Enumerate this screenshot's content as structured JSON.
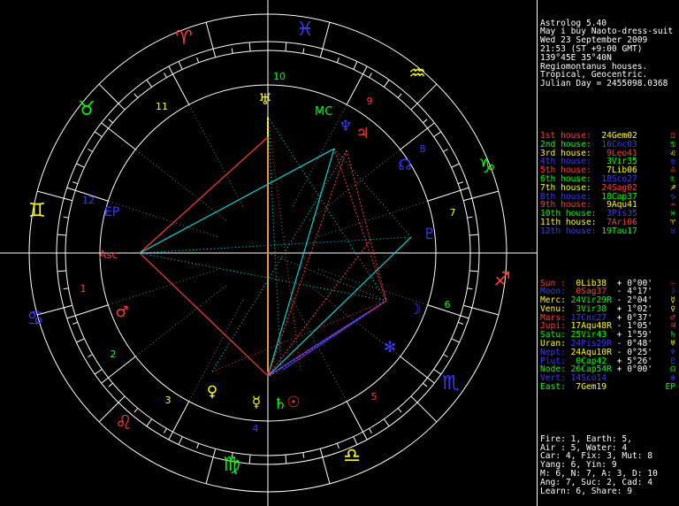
{
  "header": [
    "Astrolog 5.40",
    "May i buy Naoto-dress-suit",
    "Wed 23 September 2009",
    "21:53 (ST +9:00 GMT)",
    "139°45E 35°40N",
    "Regiomontanus houses.",
    "Tropical, Geocentric.",
    "Julian Day = 2455098.0368"
  ],
  "houses": [
    {
      "label": "1st house:",
      "value": "24Gem02",
      "icon": "♊",
      "color": "#ff3b3b",
      "vcolor": "#ffff00"
    },
    {
      "label": "2nd house:",
      "value": "16Cnc03",
      "icon": "♋",
      "color": "#00ff00",
      "vcolor": "#3a3aff"
    },
    {
      "label": "3rd house:",
      "value": " 9Leo41",
      "icon": "♌",
      "color": "#ffff00",
      "vcolor": "#ff3b3b"
    },
    {
      "label": "4th house:",
      "value": " 3Vir35",
      "icon": "♍",
      "color": "#3a3aff",
      "vcolor": "#00ff00"
    },
    {
      "label": "5th house:",
      "value": " 7Lib06",
      "icon": "♎",
      "color": "#ff3b3b",
      "vcolor": "#ffff00"
    },
    {
      "label": "6th house:",
      "value": "18Sco27",
      "icon": "♏",
      "color": "#00ff00",
      "vcolor": "#3a3aff"
    },
    {
      "label": "7th house:",
      "value": "24Sag02",
      "icon": "♐",
      "color": "#ffff00",
      "vcolor": "#ff3b3b"
    },
    {
      "label": "8th house:",
      "value": "18Cap37",
      "icon": "♑",
      "color": "#3a3aff",
      "vcolor": "#00ff00"
    },
    {
      "label": "9th house:",
      "value": " 9Aqu41",
      "icon": "♒",
      "color": "#ff3b3b",
      "vcolor": "#ffff00"
    },
    {
      "label": "10th house:",
      "value": " 3Pis35",
      "icon": "♓",
      "color": "#00ff00",
      "vcolor": "#3a3aff"
    },
    {
      "label": "11th house:",
      "value": " 7Ari06",
      "icon": "♈",
      "color": "#ffff00",
      "vcolor": "#ff3b3b"
    },
    {
      "label": "12th house:",
      "value": "19Tau17",
      "icon": "♉",
      "color": "#3a3aff",
      "vcolor": "#00ff00"
    }
  ],
  "planets": [
    {
      "label": "Sun :",
      "value": " 0Lib38",
      "info": " + 0°00'",
      "icon": "☉",
      "color": "#ff3b3b",
      "vcolor": "#ffff00"
    },
    {
      "label": "Moon:",
      "value": " 0Sag37",
      "info": " - 4°17'",
      "icon": "☽",
      "color": "#3a3aff",
      "vcolor": "#ff3b3b"
    },
    {
      "label": "Merc:",
      "value": "24Vir29R",
      "info": " - 2°04'",
      "icon": "☿",
      "color": "#ffff00",
      "vcolor": "#00ff00"
    },
    {
      "label": "Venu:",
      "value": " 3Vir38",
      "info": " + 1°02'",
      "icon": "♀",
      "color": "#ffff00",
      "vcolor": "#00ff00"
    },
    {
      "label": "Mars:",
      "value": "17Cnc27",
      "info": " + 0°37'",
      "icon": "♂",
      "color": "#ff3b3b",
      "vcolor": "#3a3aff"
    },
    {
      "label": "Jupi:",
      "value": "17Aqu48R",
      "info": " - 1°05'",
      "icon": "♃",
      "color": "#ff3b3b",
      "vcolor": "#ffff00"
    },
    {
      "label": "Satu:",
      "value": "25Vir43",
      "info": " + 1°59'",
      "icon": "♄",
      "color": "#00ff00",
      "vcolor": "#00ff00"
    },
    {
      "label": "Uran:",
      "value": "24Pis29R",
      "info": " - 0°48'",
      "icon": "♅",
      "color": "#ffff00",
      "vcolor": "#3a3aff"
    },
    {
      "label": "Nept:",
      "value": "24Aqu10R",
      "info": " - 0°25'",
      "icon": "♆",
      "color": "#3a3aff",
      "vcolor": "#ffff00"
    },
    {
      "label": "Plut:",
      "value": " 0Cap42",
      "info": " + 5°26'",
      "icon": "♇",
      "color": "#3a3aff",
      "vcolor": "#00ff00"
    },
    {
      "label": "Node:",
      "value": "26Cap54R",
      "info": " + 0°00'",
      "icon": "☊",
      "color": "#00ff00",
      "vcolor": "#00ff00"
    },
    {
      "label": "Vert:",
      "value": "14Sco14",
      "info": "",
      "icon": "✻",
      "color": "#3a3aff",
      "vcolor": "#3a3aff"
    },
    {
      "label": "East:",
      "value": " 7Gem19",
      "info": "",
      "icon": "EP",
      "color": "#00ff00",
      "vcolor": "#ffff00"
    }
  ],
  "stats": [
    "Fire: 1, Earth: 5,",
    "Air : 5, Water: 4",
    "Car: 4, Fix: 3, Mut: 8",
    "Yang: 6, Yin: 9",
    "M: 6, N: 7, A: 3, D: 10",
    "Ang: 7, Suc: 2, Cad: 4",
    "Learn: 6, Share: 9"
  ],
  "wheel": {
    "signs": [
      {
        "glyph": "♓",
        "color": "#3a3aff"
      },
      {
        "glyph": "♈",
        "color": "#ff3b3b"
      },
      {
        "glyph": "♉",
        "color": "#00ff00"
      },
      {
        "glyph": "♊",
        "color": "#ffff00"
      },
      {
        "glyph": "♋",
        "color": "#3a3aff"
      },
      {
        "glyph": "♌",
        "color": "#ff3b3b"
      },
      {
        "glyph": "♍",
        "color": "#00ff00"
      },
      {
        "glyph": "♎",
        "color": "#ffff00"
      },
      {
        "glyph": "♏",
        "color": "#3a3aff"
      },
      {
        "glyph": "♐",
        "color": "#ff3b3b"
      },
      {
        "glyph": "♑",
        "color": "#00ff00"
      },
      {
        "glyph": "♒",
        "color": "#ffff00"
      }
    ],
    "house_numbers": [
      {
        "n": "10",
        "color": "#00ff00"
      },
      {
        "n": "9",
        "color": "#ff3b3b"
      },
      {
        "n": "8",
        "color": "#3a3aff"
      },
      {
        "n": "7",
        "color": "#ffff00"
      },
      {
        "n": "6",
        "color": "#00ff00"
      },
      {
        "n": "5",
        "color": "#ff3b3b"
      },
      {
        "n": "4",
        "color": "#3a3aff"
      },
      {
        "n": "3",
        "color": "#ffff00"
      },
      {
        "n": "2",
        "color": "#00ff00"
      },
      {
        "n": "1",
        "color": "#ff3b3b"
      },
      {
        "n": "12",
        "color": "#3a3aff"
      },
      {
        "n": "11",
        "color": "#ffff00"
      }
    ],
    "asc_label": "Asc",
    "mc_label": "MC",
    "ep_label": "EP",
    "asc_color": "#ff3b3b",
    "mc_color": "#00ff00",
    "ep_color": "#3a3aff",
    "chart_planets": [
      {
        "glyph": "♅",
        "color": "#ffff00"
      },
      {
        "glyph": "♆",
        "color": "#3a3aff"
      },
      {
        "glyph": "♃",
        "color": "#ff3b3b"
      },
      {
        "glyph": "☊",
        "color": "#3a3aff"
      },
      {
        "glyph": "♇",
        "color": "#3a3aff"
      },
      {
        "glyph": "☽",
        "color": "#3a3aff"
      },
      {
        "glyph": "✻",
        "color": "#3a3aff"
      },
      {
        "glyph": "☉",
        "color": "#ff3b3b"
      },
      {
        "glyph": "♄",
        "color": "#00ff00"
      },
      {
        "glyph": "☿",
        "color": "#ffff00"
      },
      {
        "glyph": "♀",
        "color": "#ffff00"
      },
      {
        "glyph": "♂",
        "color": "#ff3b3b"
      }
    ]
  }
}
